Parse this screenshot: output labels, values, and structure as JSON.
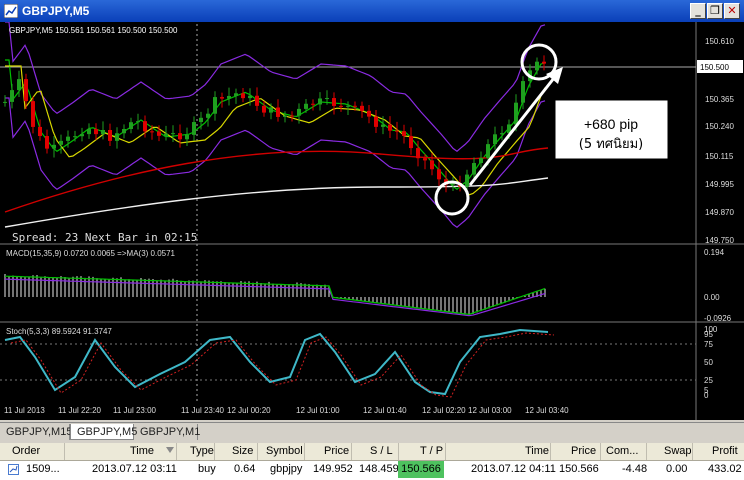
{
  "window": {
    "title": "GBPJPY,M5",
    "buttons": [
      "minimize",
      "restore",
      "close"
    ]
  },
  "chart": {
    "info_line": "GBPJPY,M5  150.561 150.561 150.500 150.500",
    "price_axis": [
      "150.610",
      "150.500",
      "150.365",
      "150.240",
      "150.115",
      "149.995",
      "149.870",
      "149.750"
    ],
    "current_price": "150.500",
    "spread_text": "Spread: 23  Next Bar in 02:15",
    "annotation_text": "+680 pip",
    "annotation_subtext": "(5 ทศนิยม)",
    "time_axis": [
      "11 Jul 2013",
      "11 Jul 22:20",
      "11 Jul 23:00",
      "11 Jul 23:40",
      "12 Jul 00:20",
      "12 Jul 01:00",
      "12 Jul 01:40",
      "12 Jul 02:20",
      "12 Jul 03:00",
      "12 Jul 03:40"
    ],
    "macd": {
      "label": "MACD(15,35,9) 0.0720 0.0065 =>MA(3) 0.0571",
      "axis": [
        "0.194",
        "0.00",
        "-0.0926"
      ]
    },
    "stoch": {
      "label": "Stoch(5,3,3) 89.5924 91.3747",
      "axis": [
        "100",
        "95",
        "75",
        "50",
        "25",
        "5",
        "0"
      ]
    },
    "colors": {
      "bull": "#1fa01f",
      "bear": "#e00000",
      "bands": "#8a2be2",
      "ma_fast": "#00c000",
      "ma_yellow": "#d8d800",
      "ma_red": "#d00000",
      "ma_white": "#f0f0f0",
      "annotation": "#ffffff"
    }
  },
  "tabs": [
    {
      "label": "GBPJPY,M15",
      "active": false
    },
    {
      "label": "GBPJPY,M5",
      "active": true
    },
    {
      "label": "GBPJPY,M1",
      "active": false
    }
  ],
  "orders": {
    "headers": [
      "Order",
      "Time",
      "Type",
      "Size",
      "Symbol",
      "Price",
      "S / L",
      "T / P",
      "Time",
      "Price",
      "Com...",
      "Swap",
      "Profit"
    ],
    "rows": [
      [
        "1509...",
        "2013.07.12 03:11",
        "buy",
        "0.64",
        "gbpjpy",
        "149.952",
        "148.459",
        "150.566",
        "2013.07.12 04:11",
        "150.566",
        "-4.48",
        "0.00",
        "433.02"
      ]
    ]
  }
}
